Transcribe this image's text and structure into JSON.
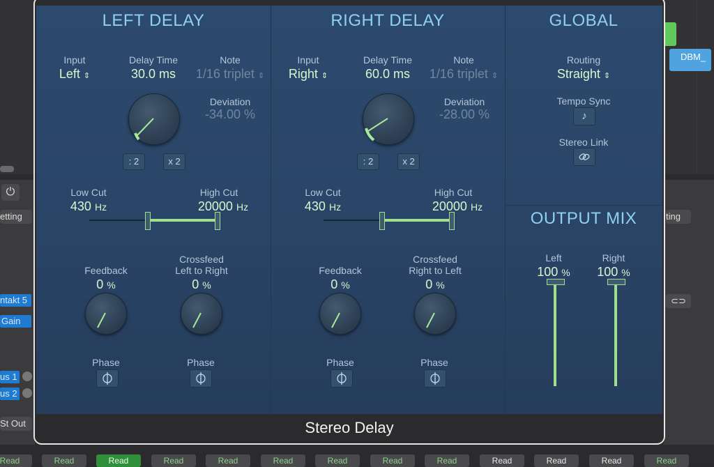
{
  "plugin": {
    "name": "Stereo Delay",
    "left": {
      "title": "LEFT DELAY",
      "input_label": "Input",
      "input_value": "Left",
      "delay_time_label": "Delay Time",
      "delay_time_value": "30.0 ms",
      "note_label": "Note",
      "note_value": "1/16 triplet",
      "deviation_label": "Deviation",
      "deviation_value": "-34.00 %",
      "half_button": ": 2",
      "double_button": "x 2",
      "low_cut_label": "Low Cut",
      "low_cut_value": "430",
      "low_cut_unit": "Hz",
      "high_cut_label": "High Cut",
      "high_cut_value": "20000",
      "high_cut_unit": "Hz",
      "feedback_label": "Feedback",
      "feedback_value": "0",
      "feedback_unit": "%",
      "crossfeed_label_1": "Crossfeed",
      "crossfeed_label_2": "Left to Right",
      "crossfeed_value": "0",
      "crossfeed_unit": "%",
      "phase_label_1": "Phase",
      "phase_label_2": "Phase"
    },
    "right": {
      "title": "RIGHT DELAY",
      "input_label": "Input",
      "input_value": "Right",
      "delay_time_label": "Delay Time",
      "delay_time_value": "60.0 ms",
      "note_label": "Note",
      "note_value": "1/16 triplet",
      "deviation_label": "Deviation",
      "deviation_value": "-28.00 %",
      "half_button": ": 2",
      "double_button": "x 2",
      "low_cut_label": "Low Cut",
      "low_cut_value": "430",
      "low_cut_unit": "Hz",
      "high_cut_label": "High Cut",
      "high_cut_value": "20000",
      "high_cut_unit": "Hz",
      "feedback_label": "Feedback",
      "feedback_value": "0",
      "feedback_unit": "%",
      "crossfeed_label_1": "Crossfeed",
      "crossfeed_label_2": "Right to Left",
      "crossfeed_value": "0",
      "crossfeed_unit": "%",
      "phase_label_1": "Phase",
      "phase_label_2": "Phase"
    },
    "global": {
      "title": "GLOBAL",
      "routing_label": "Routing",
      "routing_value": "Straight",
      "tempo_sync_label": "Tempo Sync",
      "stereo_link_label": "Stereo Link"
    },
    "output_mix": {
      "title": "OUTPUT MIX",
      "left_label": "Left",
      "left_value": "100",
      "left_unit": "%",
      "right_label": "Right",
      "right_value": "100",
      "right_unit": "%"
    }
  },
  "background": {
    "track_region": "DBM_",
    "left_pills": [
      "etting",
      "ntakt 5",
      "Gain",
      "us 1",
      "us 2",
      "St Out"
    ],
    "right_pill": "ting",
    "read_label": "Read"
  },
  "colors": {
    "accent_value": "#d7f7d0",
    "section_title": "#8fd0f0",
    "panel_blue": "#2a4466",
    "slider_green": "#9fe08f"
  }
}
